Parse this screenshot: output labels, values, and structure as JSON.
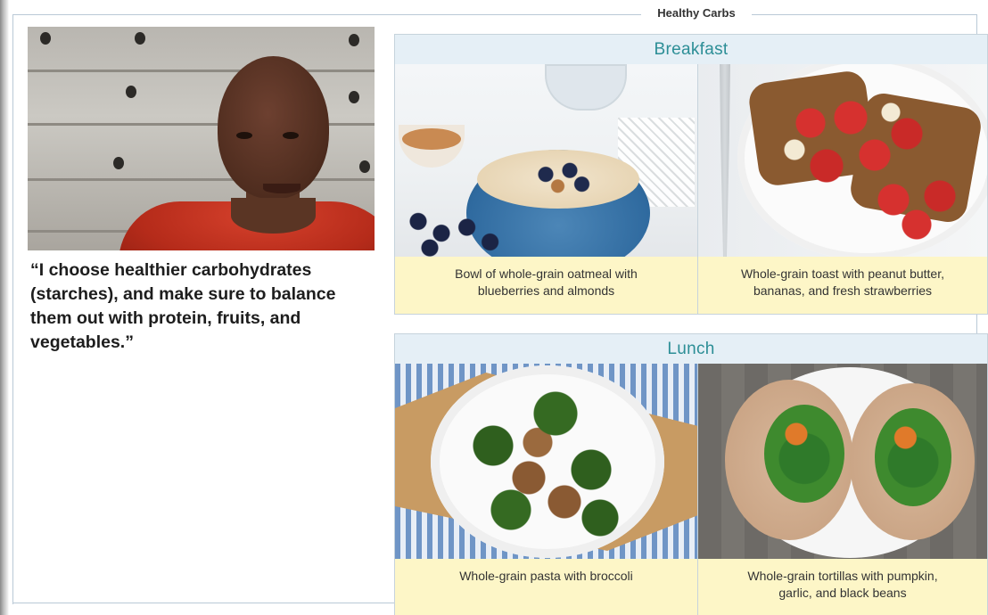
{
  "page": {
    "section_title": "Healthy Carbs"
  },
  "testimonial": {
    "photo_alt": "person-photo",
    "quote_lines": [
      "“I choose healthier carbohydrates",
      "(starches), and make sure to balance",
      "them out with protein, fruits, and",
      "vegetables.”"
    ]
  },
  "meals": [
    {
      "heading": "Breakfast",
      "items": [
        {
          "caption_line1": "Bowl of whole-grain oatmeal with",
          "caption_line2": "blueberries and almonds"
        },
        {
          "caption_line1": "Whole-grain toast with peanut butter,",
          "caption_line2": "bananas, and fresh strawberries"
        }
      ]
    },
    {
      "heading": "Lunch",
      "items": [
        {
          "caption_line1": "Whole-grain pasta with broccoli",
          "caption_line2": ""
        },
        {
          "caption_line1": "Whole-grain tortillas with pumpkin,",
          "caption_line2": "garlic, and black beans"
        }
      ]
    }
  ],
  "colors": {
    "heading_text": "#2c8e96",
    "heading_bg": "#e5eff6",
    "caption_bg": "#fdf6c7",
    "border": "#c6d3dc"
  }
}
